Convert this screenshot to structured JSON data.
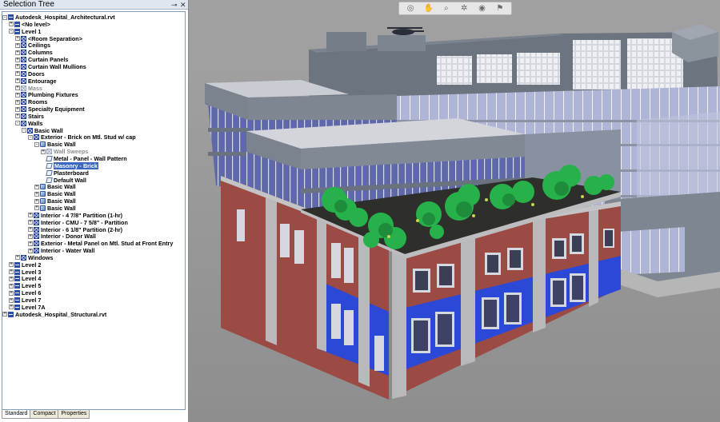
{
  "panel": {
    "title": "Selection Tree",
    "pin_glyph": "⊸",
    "close_glyph": "✕",
    "tabs": [
      "Standard",
      "Compact",
      "Properties"
    ],
    "tree": [
      {
        "label": "Autodesk_Hospital_Architectural.rvt",
        "depth": 0,
        "icon": "file-icon",
        "exp": "-"
      },
      {
        "label": "<No level>",
        "depth": 1,
        "icon": "level-icon",
        "exp": "+"
      },
      {
        "label": "Level 1",
        "depth": 1,
        "icon": "level-icon",
        "exp": "-"
      },
      {
        "label": "<Room Separation>",
        "depth": 2,
        "icon": "category-icon",
        "exp": "+"
      },
      {
        "label": "Ceilings",
        "depth": 2,
        "icon": "category-icon",
        "exp": "+"
      },
      {
        "label": "Columns",
        "depth": 2,
        "icon": "category-icon",
        "exp": "+"
      },
      {
        "label": "Curtain Panels",
        "depth": 2,
        "icon": "category-icon",
        "exp": "+"
      },
      {
        "label": "Curtain Wall Mullions",
        "depth": 2,
        "icon": "category-icon",
        "exp": "+"
      },
      {
        "label": "Doors",
        "depth": 2,
        "icon": "category-icon",
        "exp": "+"
      },
      {
        "label": "Entourage",
        "depth": 2,
        "icon": "category-icon",
        "exp": "+"
      },
      {
        "label": "Mass",
        "depth": 2,
        "icon": "category-icon",
        "exp": "+",
        "muted": true
      },
      {
        "label": "Plumbing Fixtures",
        "depth": 2,
        "icon": "category-icon",
        "exp": "+"
      },
      {
        "label": "Rooms",
        "depth": 2,
        "icon": "category-icon",
        "exp": "+"
      },
      {
        "label": "Specialty Equipment",
        "depth": 2,
        "icon": "category-icon",
        "exp": "+"
      },
      {
        "label": "Stairs",
        "depth": 2,
        "icon": "category-icon",
        "exp": "+"
      },
      {
        "label": "Walls",
        "depth": 2,
        "icon": "category-icon",
        "exp": "-"
      },
      {
        "label": "Basic Wall",
        "depth": 3,
        "icon": "category-icon",
        "exp": "-"
      },
      {
        "label": "Exterior - Brick on Mtl. Stud w/ cap",
        "depth": 4,
        "icon": "category-icon",
        "exp": "-"
      },
      {
        "label": "Basic Wall",
        "depth": 5,
        "icon": "group-icon",
        "exp": "-"
      },
      {
        "label": "Wall Sweeps",
        "depth": 6,
        "icon": "category-icon",
        "exp": "+",
        "muted": true
      },
      {
        "label": "Metal - Panel - Wall Pattern",
        "depth": 6,
        "icon": "geometry-icon",
        "exp": ""
      },
      {
        "label": "Masonry - Brick",
        "depth": 6,
        "icon": "geometry-icon",
        "exp": "",
        "selected": true
      },
      {
        "label": "Plasterboard",
        "depth": 6,
        "icon": "geometry-icon",
        "exp": ""
      },
      {
        "label": "Default Wall",
        "depth": 6,
        "icon": "geometry-icon",
        "exp": ""
      },
      {
        "label": "Basic Wall",
        "depth": 5,
        "icon": "group-icon",
        "exp": "+"
      },
      {
        "label": "Basic Wall",
        "depth": 5,
        "icon": "group-icon",
        "exp": "+"
      },
      {
        "label": "Basic Wall",
        "depth": 5,
        "icon": "group-icon",
        "exp": "+"
      },
      {
        "label": "Basic Wall",
        "depth": 5,
        "icon": "group-icon",
        "exp": "+"
      },
      {
        "label": "Interior - 4 7/8\" Partition (1-hr)",
        "depth": 4,
        "icon": "category-icon",
        "exp": "+"
      },
      {
        "label": "Interior - CMU - 7 5/8\" - Partition",
        "depth": 4,
        "icon": "category-icon",
        "exp": "+"
      },
      {
        "label": "Interior - 6 1/8\" Partition (2-hr)",
        "depth": 4,
        "icon": "category-icon",
        "exp": "+"
      },
      {
        "label": "Interior - Donor Wall",
        "depth": 4,
        "icon": "category-icon",
        "exp": "+"
      },
      {
        "label": "Exterior - Metal Panel on Mtl. Stud at Front Entry",
        "depth": 4,
        "icon": "category-icon",
        "exp": "+"
      },
      {
        "label": "Interior - Water Wall",
        "depth": 4,
        "icon": "category-icon",
        "exp": "+"
      },
      {
        "label": "Windows",
        "depth": 2,
        "icon": "category-icon",
        "exp": "+"
      },
      {
        "label": "Level 2",
        "depth": 1,
        "icon": "level-icon",
        "exp": "+"
      },
      {
        "label": "Level 3",
        "depth": 1,
        "icon": "level-icon",
        "exp": "+"
      },
      {
        "label": "Level 4",
        "depth": 1,
        "icon": "level-icon",
        "exp": "+"
      },
      {
        "label": "Level 5",
        "depth": 1,
        "icon": "level-icon",
        "exp": "+"
      },
      {
        "label": "Level 6",
        "depth": 1,
        "icon": "level-icon",
        "exp": "+"
      },
      {
        "label": "Level 7",
        "depth": 1,
        "icon": "level-icon",
        "exp": "+"
      },
      {
        "label": "Level 7A",
        "depth": 1,
        "icon": "level-icon",
        "exp": "+"
      },
      {
        "label": "Autodesk_Hospital_Structural.rvt",
        "depth": 0,
        "icon": "file-icon",
        "exp": "+"
      }
    ]
  },
  "navigation_bar": {
    "tools": [
      {
        "name": "steering-wheel-icon",
        "glyph": "◎"
      },
      {
        "name": "pan-hand-icon",
        "glyph": "✋"
      },
      {
        "name": "zoom-window-icon",
        "glyph": "⌕"
      },
      {
        "name": "orbit-icon",
        "glyph": "✲"
      },
      {
        "name": "look-around-icon",
        "glyph": "◉"
      },
      {
        "name": "walk-icon",
        "glyph": "⚑"
      }
    ]
  },
  "colors": {
    "selection": "#3b66c2",
    "viewport_background": "#9c9c9c",
    "brick": "#9b4a44",
    "glazing_blue": "#2c48d6",
    "curtain_glass": "#a9b4d8",
    "metal_panel": "#6b7480",
    "roof_garden": "#2e2f2b",
    "tree_green": "#27b14a"
  }
}
